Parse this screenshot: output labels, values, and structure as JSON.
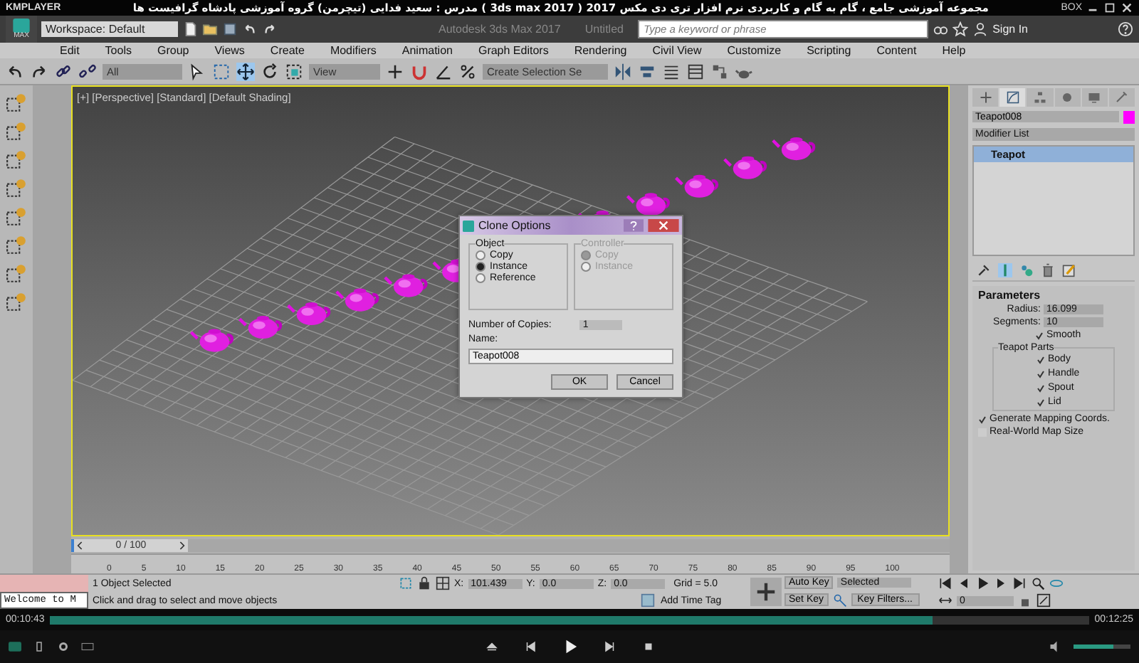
{
  "player": {
    "brand": "KMPLAYER",
    "title": "مجموعه آموزشی جامع ، گام به گام و کاربردی نرم افزار تری دی مکس 2017  ( 3ds max 2017 )  مدرس : سعید فدایی (تیچرمن) گروه آموزشی پادشاه گرافیست ها",
    "box_label": "BOX",
    "elapsed": "00:10:43",
    "total": "00:12:25",
    "seek": {
      "level": 0.85
    },
    "volume": {
      "level": 0.7
    }
  },
  "app": {
    "logo_label": "MAX",
    "workspace": "Workspace: Default",
    "title": "Autodesk 3ds Max 2017",
    "document": "Untitled",
    "search": {
      "placeholder": "Type a keyword or phrase"
    },
    "sign_in": "Sign In"
  },
  "menu": [
    "Edit",
    "Tools",
    "Group",
    "Views",
    "Create",
    "Modifiers",
    "Animation",
    "Graph Editors",
    "Rendering",
    "Civil View",
    "Customize",
    "Scripting",
    "Content",
    "Help"
  ],
  "toolbar": {
    "selection_filter": "All",
    "reference_coord": "View",
    "selection_set": "Create Selection Se"
  },
  "viewport": {
    "label": "[+] [Perspective] [Standard] [Default Shading]"
  },
  "dialog": {
    "title": "Clone Options",
    "object": {
      "label": "Object",
      "disabled": false,
      "options": [
        {
          "label": "Copy",
          "selected": false
        },
        {
          "label": "Instance",
          "selected": true
        },
        {
          "label": "Reference",
          "selected": false
        }
      ]
    },
    "controller": {
      "label": "Controller",
      "disabled": true,
      "options": [
        {
          "label": "Copy",
          "selected": true
        },
        {
          "label": "Instance",
          "selected": false
        }
      ]
    },
    "copies": {
      "label": "Number of Copies:",
      "value": "1"
    },
    "name": {
      "label": "Name:",
      "value": "Teapot008"
    },
    "buttons": [
      "OK",
      "Cancel"
    ]
  },
  "command_panel": {
    "tabs": [
      {
        "kind": "create",
        "selected": false
      },
      {
        "kind": "modify",
        "selected": true
      },
      {
        "kind": "hierarchy",
        "selected": false
      },
      {
        "kind": "motion",
        "selected": false
      },
      {
        "kind": "display",
        "selected": false
      },
      {
        "kind": "utilities",
        "selected": false
      }
    ],
    "object_name": "Teapot008",
    "modifier_list": "Modifier List",
    "stack": [
      {
        "label": "Teapot",
        "selected": true
      }
    ],
    "rollout": {
      "title": "Parameters",
      "fields": [
        {
          "label": "Radius:",
          "value": "16.099"
        },
        {
          "label": "Segments:",
          "value": "10"
        }
      ],
      "smooth": {
        "label": "Smooth",
        "checked": true
      },
      "parts_label": "Teapot Parts",
      "parts": [
        {
          "label": "Body",
          "checked": true
        },
        {
          "label": "Handle",
          "checked": true
        },
        {
          "label": "Spout",
          "checked": true
        },
        {
          "label": "Lid",
          "checked": true
        }
      ],
      "options": [
        {
          "label": "Generate Mapping Coords.",
          "checked": true
        },
        {
          "label": "Real-World Map Size",
          "checked": false
        }
      ]
    }
  },
  "timeline": {
    "counter": "0 / 100",
    "level": 0,
    "ticks": [
      "0",
      "5",
      "10",
      "15",
      "20",
      "25",
      "30",
      "35",
      "40",
      "45",
      "50",
      "55",
      "60",
      "65",
      "70",
      "75",
      "80",
      "85",
      "90",
      "95",
      "100"
    ]
  },
  "status": {
    "listener": "Welcome to M",
    "selection": "1 Object Selected",
    "prompt": "Click and drag to select and move objects",
    "coords": [
      {
        "label": "X:",
        "value": "101.439"
      },
      {
        "label": "Y:",
        "value": "0.0"
      },
      {
        "label": "Z:",
        "value": "0.0"
      }
    ],
    "grid": "Grid = 5.0",
    "time_tag": "Add Time Tag",
    "auto_key": "Auto Key",
    "key_mode": "Selected",
    "set_key": "Set Key",
    "key_filters": "Key Filters...",
    "frame": "0"
  }
}
